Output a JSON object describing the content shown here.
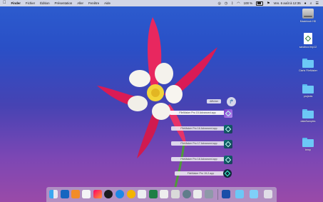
{
  "menubar": {
    "apple": "",
    "app_name": "Finder",
    "menus": [
      "Fichier",
      "Édition",
      "Présentation",
      "Aller",
      "Fenêtre",
      "Aide"
    ],
    "status_icons": [
      "airdrop-icon",
      "timer-icon",
      "bluetooth-icon",
      "wifi-icon",
      "battery-icon",
      "flag-icon",
      "user-icon",
      "search-icon",
      "list-icon"
    ],
    "battery": "100 %",
    "clock": "Ven. 6 août à 12:35"
  },
  "desktop_icons": [
    {
      "label": "Macintosh HD",
      "icon": "hard-drive-icon"
    },
    {
      "label": "sandbox.fmp12",
      "icon": "filemaker-document-icon"
    },
    {
      "label": "Clarls FileMaker",
      "icon": "folder-icon"
    },
    {
      "label": "projects",
      "icon": "folder-icon"
    },
    {
      "label": "dataSamples",
      "icon": "folder-icon"
    },
    {
      "label": "temp",
      "icon": "folder-icon"
    }
  ],
  "stack": {
    "open_label": "Afficher",
    "items": [
      {
        "label": "FileMaker Pro 15 Advanced.app"
      },
      {
        "label": "FileMaker Pro 16 Advanced.app"
      },
      {
        "label": "FileMaker Pro 17 Advanced.app"
      },
      {
        "label": "FileMaker Pro 18 Advanced.app"
      },
      {
        "label": "FileMaker Pro 19-2.app"
      }
    ]
  },
  "dock": {
    "apps": [
      "finder-icon",
      "outlook-icon",
      "pages-icon",
      "slack-icon",
      "launchpad-icon",
      "chrome-icon",
      "safari-icon",
      "app-store-icon",
      "photos-icon",
      "excel-icon",
      "notes-icon",
      "calendar-icon",
      "preview-icon",
      "screenshot-icon",
      "downloads-stack-icon",
      "applications-folder-icon",
      "documents-folder-icon",
      "trash-icon"
    ]
  }
}
